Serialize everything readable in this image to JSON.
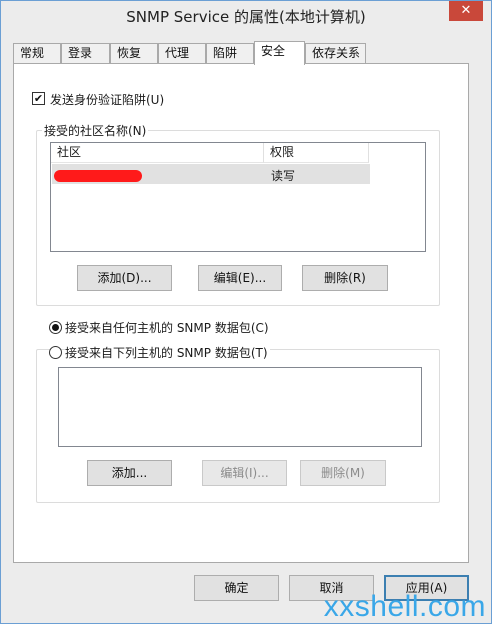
{
  "window": {
    "title": "SNMP Service 的属性(本地计算机)",
    "close_glyph": "✕"
  },
  "tabs": [
    {
      "label": "常规"
    },
    {
      "label": "登录"
    },
    {
      "label": "恢复"
    },
    {
      "label": "代理"
    },
    {
      "label": "陷阱"
    },
    {
      "label": "安全",
      "active": true
    },
    {
      "label": "依存关系"
    }
  ],
  "security": {
    "send_auth_trap_label": "发送身份验证陷阱(U)",
    "send_auth_trap_checked": true,
    "check_glyph": "✔",
    "community_group_title": "接受的社区名称(N)",
    "columns": [
      "社区",
      "权限"
    ],
    "rows": [
      {
        "community": "",
        "permission": "读写",
        "redacted": true
      }
    ],
    "community_buttons": {
      "add": "添加(D)...",
      "edit": "编辑(E)...",
      "remove": "删除(R)"
    },
    "accept_any_label": "接受来自任何主机的 SNMP 数据包(C)",
    "accept_list_label": "接受来自下列主机的 SNMP 数据包(T)",
    "accept_any_selected": true,
    "host_buttons": {
      "add": "添加...",
      "edit": "编辑(I)...",
      "remove": "删除(M)"
    }
  },
  "footer": {
    "ok": "确定",
    "cancel": "取消",
    "apply": "应用(A)"
  },
  "watermark": "xxshell.com",
  "colors": {
    "accent_border": "#3c7fb1",
    "close_button": "#c9483a",
    "watermark": "#3aa7e8",
    "redaction": "#ff1a1a"
  }
}
